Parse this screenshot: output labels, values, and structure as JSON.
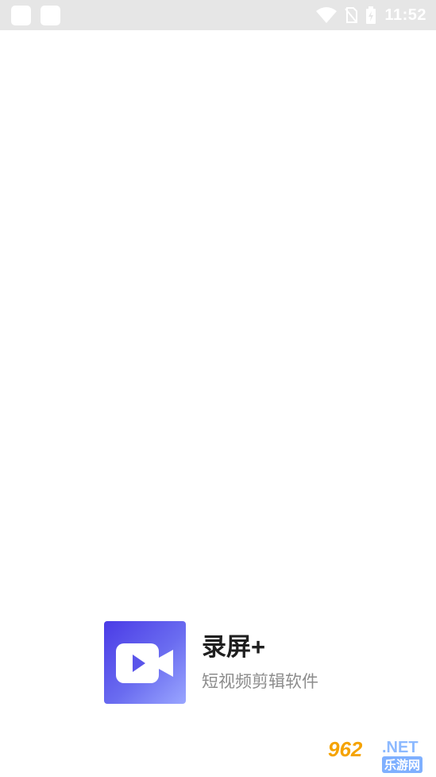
{
  "status_bar": {
    "time": "11:52",
    "icons": [
      "wifi-icon",
      "no-sim-icon",
      "battery-charging-icon"
    ]
  },
  "splash": {
    "app_name": "录屏+",
    "tagline": "短视频剪辑软件",
    "icon": "video-camera-icon",
    "colors": {
      "icon_gradient_start": "#4a3be6",
      "icon_gradient_end": "#9aa6ff"
    }
  },
  "watermark": {
    "number": "962",
    "suffix": ".NET",
    "chinese": "乐游网"
  }
}
